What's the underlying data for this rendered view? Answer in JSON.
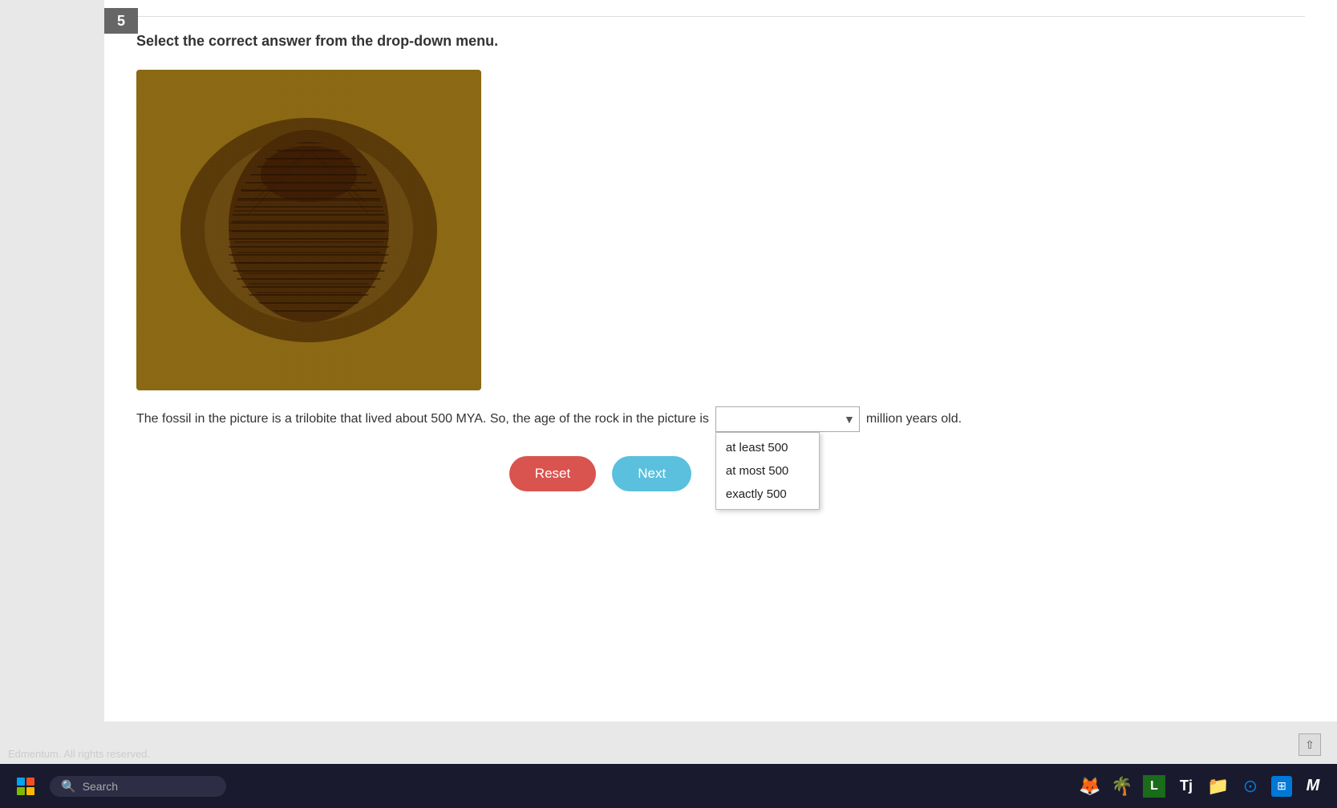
{
  "page": {
    "question_number": "5",
    "instruction": "Select the correct answer from the drop-down menu.",
    "fossil_caption": "The fossil in the picture is a trilobite that lived about 500 MYA. So, the age of the rock in the picture is",
    "suffix_text": "million years old.",
    "dropdown_placeholder": "",
    "dropdown_options": [
      {
        "value": "at_least_500",
        "label": "at least 500"
      },
      {
        "value": "at_most_500",
        "label": "at most 500"
      },
      {
        "value": "exactly_500",
        "label": "exactly 500"
      }
    ],
    "reset_label": "Reset",
    "next_label": "Next",
    "copyright": "Edmentum. All rights reserved.",
    "taskbar": {
      "search_placeholder": "Search"
    }
  }
}
